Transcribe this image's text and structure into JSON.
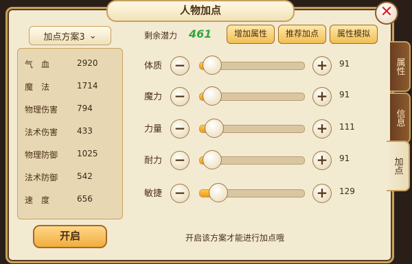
{
  "title": "人物加点",
  "close": "✕",
  "side_tabs": [
    "属性",
    "信息",
    "加点"
  ],
  "scheme": {
    "label": "加点方案3",
    "chevron": "⌄"
  },
  "stats": [
    {
      "name": "气　血",
      "value": "2920"
    },
    {
      "name": "魔　法",
      "value": "1714"
    },
    {
      "name": "物理伤害",
      "value": "794"
    },
    {
      "name": "法术伤害",
      "value": "433"
    },
    {
      "name": "物理防御",
      "value": "1025"
    },
    {
      "name": "法术防御",
      "value": "542"
    },
    {
      "name": "速　度",
      "value": "656"
    }
  ],
  "open_button": "开启",
  "remaining": {
    "label": "剩余潜力",
    "value": "461"
  },
  "buttons": {
    "add": "增加属性",
    "recommend": "推荐加点",
    "simulate": "属性模拟"
  },
  "attributes": [
    {
      "label": "体质",
      "value": "91",
      "fill": 0.12
    },
    {
      "label": "魔力",
      "value": "91",
      "fill": 0.12
    },
    {
      "label": "力量",
      "value": "111",
      "fill": 0.14
    },
    {
      "label": "耐力",
      "value": "91",
      "fill": 0.12
    },
    {
      "label": "敏捷",
      "value": "129",
      "fill": 0.18
    }
  ],
  "minus": "−",
  "plus": "+",
  "hint": "开启该方案才能进行加点哦"
}
